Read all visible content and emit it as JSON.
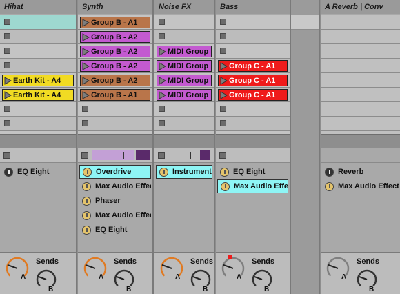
{
  "colors": {
    "cyan": "#9ed8d0",
    "brown": "#b9754a",
    "purple": "#c35ad0",
    "yellow": "#f1db23",
    "red": "#ef1b1b",
    "device_selected": "#8ef5f5",
    "knob_orange": "#e07a22",
    "knob_gray": "#7f7f7f"
  },
  "tracks": [
    {
      "name": "Hihat",
      "slots": [
        {
          "type": "highlight",
          "color": "#9ed8d0"
        },
        {
          "type": "stop"
        },
        {
          "type": "stop"
        },
        {
          "type": "stop"
        },
        {
          "type": "clip",
          "label": "Earth Kit - A4",
          "color": "#f1db23"
        },
        {
          "type": "clip",
          "label": "Earth Kit - A4",
          "color": "#f1db23"
        },
        {
          "type": "stop"
        },
        {
          "type": "stop"
        },
        {
          "type": "stop"
        }
      ],
      "devices": [
        {
          "label": "EQ Eight",
          "power": "off",
          "selected": false
        }
      ],
      "sends_label": "Sends",
      "knob_a": "A",
      "knob_b": "B",
      "knob_color": "#e07a22"
    },
    {
      "name": "Synth",
      "slots": [
        {
          "type": "clip",
          "label": "Group B - A1",
          "color": "#b9754a"
        },
        {
          "type": "clip",
          "label": "Group B - A2",
          "color": "#c35ad0"
        },
        {
          "type": "clip",
          "label": "Group B - A2",
          "color": "#c35ad0"
        },
        {
          "type": "clip",
          "label": "Group B - A2",
          "color": "#c35ad0"
        },
        {
          "type": "clip",
          "label": "Group B - A2",
          "color": "#b9754a"
        },
        {
          "type": "clip",
          "label": "Group B - A1",
          "color": "#b9754a"
        },
        {
          "type": "stop"
        },
        {
          "type": "stop"
        },
        {
          "type": "stop"
        }
      ],
      "devices": [
        {
          "label": "Overdrive",
          "power": "on",
          "selected": true
        },
        {
          "label": "Max Audio Effect",
          "power": "on",
          "selected": false
        },
        {
          "label": "Phaser",
          "power": "on",
          "selected": false
        },
        {
          "label": "Max Audio Effect",
          "power": "on",
          "selected": false
        },
        {
          "label": "EQ Eight",
          "power": "on",
          "selected": false
        }
      ],
      "sends_label": "Sends",
      "knob_a": "A",
      "knob_b": "B",
      "knob_color": "#e07a22"
    },
    {
      "name": "Noise FX",
      "slots": [
        {
          "type": "stop"
        },
        {
          "type": "stop"
        },
        {
          "type": "clip",
          "label": "MIDI Group",
          "color": "#c35ad0"
        },
        {
          "type": "clip",
          "label": "MIDI Group",
          "color": "#c35ad0"
        },
        {
          "type": "clip",
          "label": "MIDI Group",
          "color": "#c35ad0"
        },
        {
          "type": "clip",
          "label": "MIDI Group",
          "color": "#c35ad0"
        },
        {
          "type": "stop"
        },
        {
          "type": "stop"
        },
        {
          "type": "stop"
        }
      ],
      "devices": [
        {
          "label": "Instrument Rack",
          "power": "on",
          "selected": true
        }
      ],
      "sends_label": "Sends",
      "knob_a": "A",
      "knob_b": "B",
      "knob_color": "#e07a22"
    },
    {
      "name": "Bass",
      "slots": [
        {
          "type": "stop"
        },
        {
          "type": "stop"
        },
        {
          "type": "stop"
        },
        {
          "type": "clip",
          "label": "Group C - A1",
          "color": "#ef1b1b"
        },
        {
          "type": "clip",
          "label": "Group C - A1",
          "color": "#ef1b1b"
        },
        {
          "type": "clip",
          "label": "Group C - A1",
          "color": "#ef1b1b"
        },
        {
          "type": "stop"
        },
        {
          "type": "stop"
        },
        {
          "type": "stop"
        }
      ],
      "devices": [
        {
          "label": "EQ Eight",
          "power": "on",
          "selected": false
        },
        {
          "label": "Max Audio Effect",
          "power": "on",
          "selected": true
        }
      ],
      "sends_label": "Sends",
      "knob_a": "A",
      "knob_b": "B",
      "knob_color": "#7f7f7f"
    },
    {
      "name": "A Reverb | Conv",
      "slots": [
        {
          "type": "empty"
        },
        {
          "type": "empty"
        },
        {
          "type": "empty"
        },
        {
          "type": "empty"
        },
        {
          "type": "empty"
        },
        {
          "type": "empty"
        },
        {
          "type": "empty"
        },
        {
          "type": "empty"
        },
        {
          "type": "empty"
        }
      ],
      "devices": [
        {
          "label": "Reverb",
          "power": "off",
          "selected": false
        },
        {
          "label": "Max Audio Effect",
          "power": "on",
          "selected": false
        }
      ],
      "sends_label": "Sends",
      "knob_a": "A",
      "knob_b": "B",
      "knob_color": "#7f7f7f"
    }
  ]
}
